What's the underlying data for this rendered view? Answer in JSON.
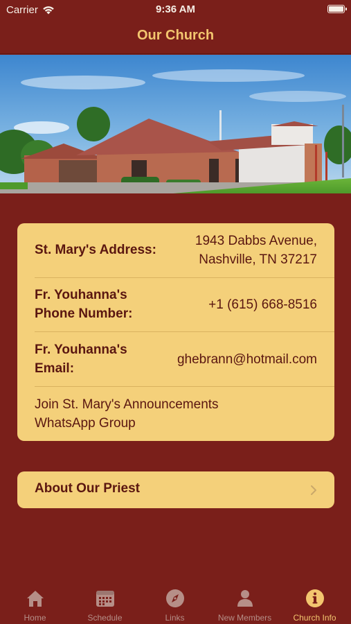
{
  "status_bar": {
    "carrier": "Carrier",
    "time": "9:36 AM"
  },
  "header": {
    "title": "Our Church"
  },
  "info_card": {
    "address": {
      "label": "St. Mary's Address:",
      "value_line1": "1943 Dabbs Avenue,",
      "value_line2": "Nashville, TN 37217"
    },
    "phone": {
      "label_line1": "Fr. Youhanna's",
      "label_line2": "Phone Number:",
      "value": "+1 (615) 668-8516"
    },
    "email": {
      "label_line1": "Fr. Youhanna's",
      "label_line2": "Email:",
      "value": "ghebrann@hotmail.com"
    },
    "whatsapp": {
      "line1": "Join St. Mary's Announcements",
      "line2": "WhatsApp Group"
    }
  },
  "about_button": {
    "label": "About Our Priest"
  },
  "tab_bar": {
    "tabs": [
      {
        "label": "Home",
        "icon": "house-icon"
      },
      {
        "label": "Schedule",
        "icon": "calendar-icon"
      },
      {
        "label": "Links",
        "icon": "compass-icon"
      },
      {
        "label": "New Members",
        "icon": "person-icon"
      },
      {
        "label": "Church Info",
        "icon": "info-icon"
      }
    ],
    "active_index": 4
  },
  "colors": {
    "background": "#7a1f1a",
    "card": "#f4d07a",
    "accent": "#f3c66f",
    "text_dark": "#5a1610",
    "tab_inactive": "#b68f88"
  }
}
